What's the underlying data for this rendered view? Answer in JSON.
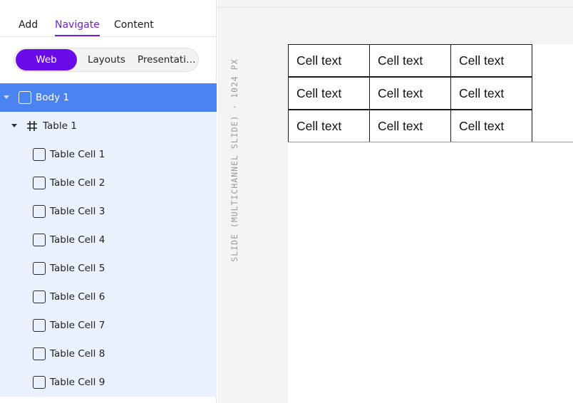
{
  "tabs": [
    {
      "label": "Add",
      "active": false
    },
    {
      "label": "Navigate",
      "active": true
    },
    {
      "label": "Content",
      "active": false
    }
  ],
  "view_switch": {
    "options": [
      "Web",
      "Layouts",
      "Presentati…"
    ],
    "selected": "Web"
  },
  "tree": {
    "body": {
      "label": "Body 1",
      "icon": "frame-icon",
      "expanded": true,
      "selected": true
    },
    "table": {
      "label": "Table 1",
      "icon": "table-grid-icon",
      "expanded": true
    },
    "cells": [
      {
        "label": "Table Cell 1"
      },
      {
        "label": "Table Cell 2"
      },
      {
        "label": "Table Cell 3"
      },
      {
        "label": "Table Cell 4"
      },
      {
        "label": "Table Cell 5"
      },
      {
        "label": "Table Cell 6"
      },
      {
        "label": "Table Cell 7"
      },
      {
        "label": "Table Cell 8"
      },
      {
        "label": "Table Cell 9"
      }
    ]
  },
  "canvas": {
    "ruler_label": "SLIDE (MULTICHANNEL SLIDE) · 1024 PX",
    "table_cells": [
      [
        "Cell text",
        "Cell text",
        "Cell text"
      ],
      [
        "Cell text",
        "Cell text",
        "Cell text"
      ],
      [
        "Cell text",
        "Cell text",
        "Cell text"
      ]
    ]
  },
  "colors": {
    "accent": "#6a0be9",
    "selection": "#4b83f2",
    "tree_background": "#eaf0fc"
  }
}
